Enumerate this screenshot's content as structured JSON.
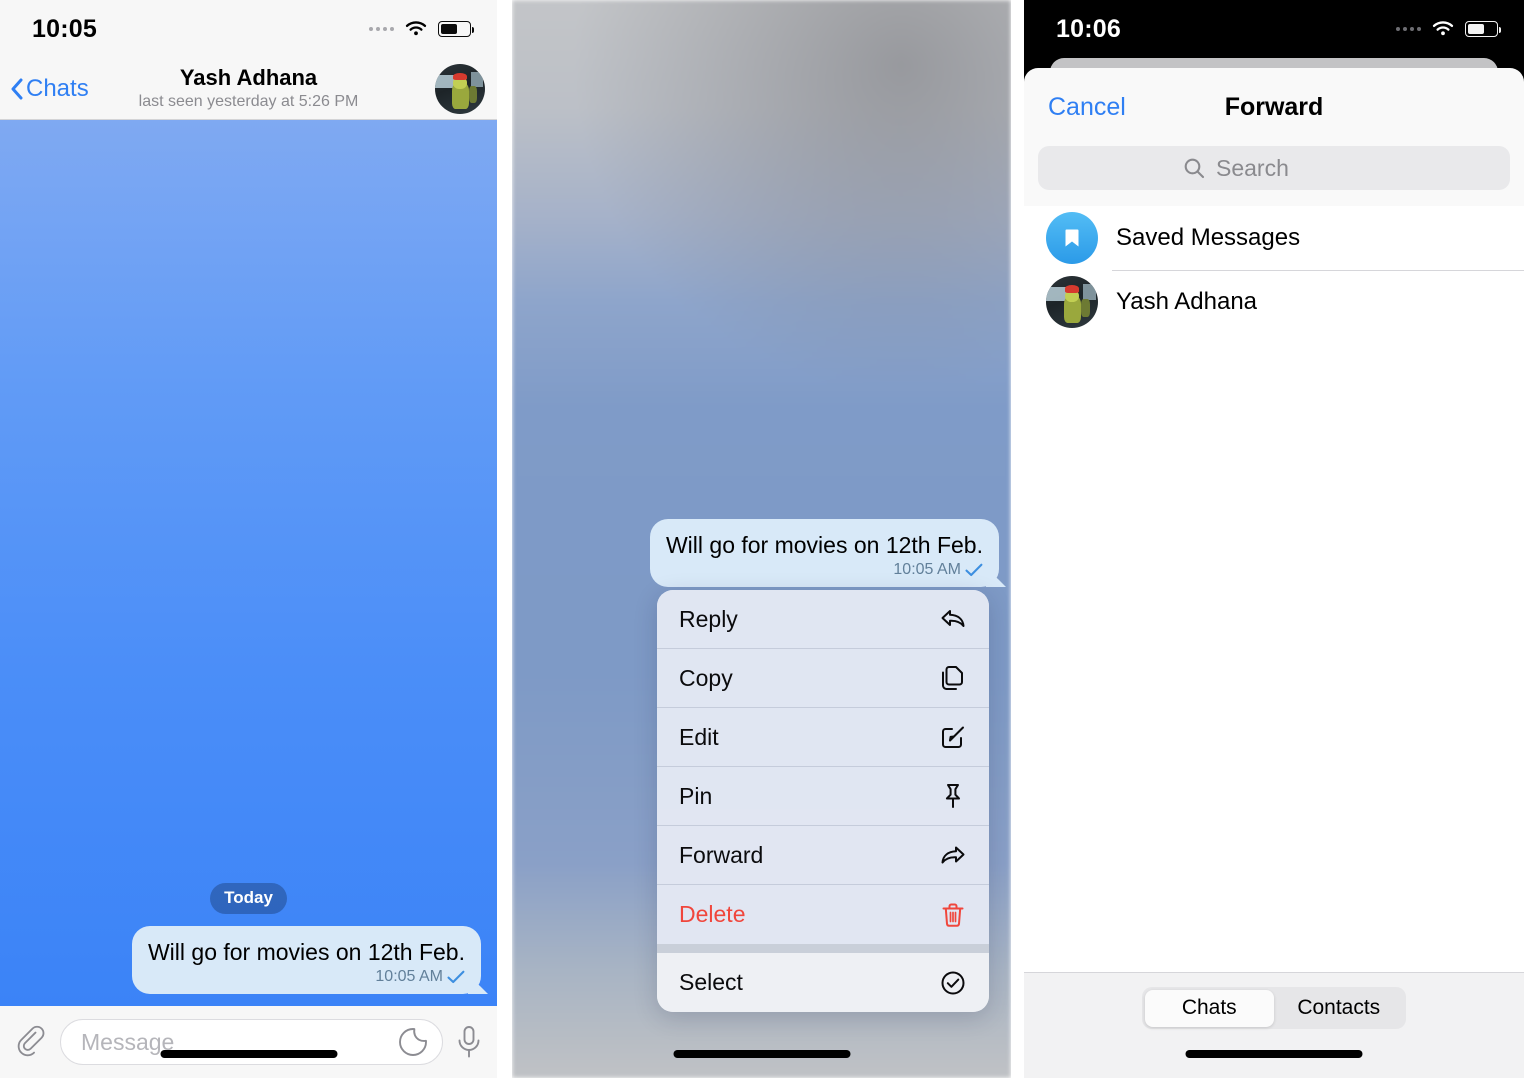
{
  "panels": {
    "chat": {
      "status": {
        "time": "10:05"
      },
      "nav": {
        "back_label": "Chats",
        "title": "Yash Adhana",
        "subtitle": "last seen yesterday at 5:26 PM"
      },
      "day_divider": "Today",
      "message": {
        "text": "Will go for movies on 12th Feb.",
        "time": "10:05 AM",
        "status_icon": "single-check-icon"
      },
      "composer": {
        "attach_icon": "paperclip-icon",
        "placeholder": "Message",
        "value": "",
        "sticker_icon": "sticker-icon",
        "mic_icon": "microphone-icon"
      }
    },
    "context_menu": {
      "message": {
        "text": "Will go for movies on 12th Feb.",
        "time": "10:05 AM",
        "status_icon": "single-check-icon"
      },
      "groups": [
        {
          "items": [
            {
              "label": "Reply",
              "icon": "reply-arrow-icon",
              "danger": false
            },
            {
              "label": "Copy",
              "icon": "copy-pages-icon",
              "danger": false
            },
            {
              "label": "Edit",
              "icon": "edit-pencil-icon",
              "danger": false
            },
            {
              "label": "Pin",
              "icon": "pushpin-icon",
              "danger": false
            },
            {
              "label": "Forward",
              "icon": "forward-arrow-icon",
              "danger": false
            },
            {
              "label": "Delete",
              "icon": "trash-icon",
              "danger": true
            }
          ]
        },
        {
          "items": [
            {
              "label": "Select",
              "icon": "check-circle-icon",
              "danger": false
            }
          ]
        }
      ]
    },
    "forward": {
      "status": {
        "time": "10:06"
      },
      "nav": {
        "cancel_label": "Cancel",
        "title": "Forward"
      },
      "search": {
        "placeholder": "Search",
        "value": "",
        "icon": "search-icon"
      },
      "rows": [
        {
          "name": "Saved Messages",
          "avatar": "bookmark-icon"
        },
        {
          "name": "Yash Adhana",
          "avatar": "user-photo"
        }
      ],
      "tabs": [
        {
          "label": "Chats",
          "active": true
        },
        {
          "label": "Contacts",
          "active": false
        }
      ]
    }
  },
  "colors": {
    "accent_blue": "#2f7ff3",
    "bubble": "#d8e9f8",
    "danger_red": "#f0463c",
    "saved_blue": "#2b9ae8"
  }
}
